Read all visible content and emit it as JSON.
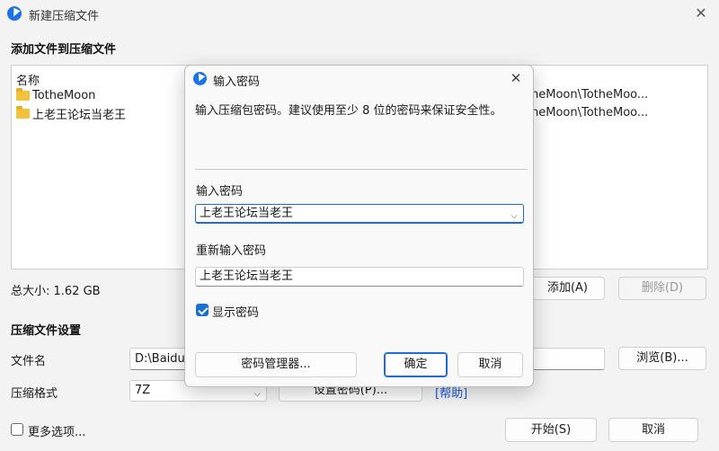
{
  "window": {
    "title": "新建压缩文件",
    "close": "✕"
  },
  "add_section": {
    "heading": "添加文件到压缩文件",
    "list_header": "名称",
    "items": [
      {
        "name": "TotheMoon",
        "path": "heMoon\\TotheMoo..."
      },
      {
        "name": "上老王论坛当老王",
        "path": "heMoon\\TotheMoo..."
      }
    ],
    "total_size": "总大小: 1.62 GB",
    "add_button": "添加(A)",
    "delete_button": "删除(D)"
  },
  "settings_section": {
    "heading": "压缩文件设置",
    "filename_label": "文件名",
    "filename_value": "D:\\BaiduN",
    "browse_button": "浏览(B)...",
    "format_label": "压缩格式",
    "format_value": "7Z",
    "set_password_button": "设置密码(P)...",
    "help_link": "[帮助]"
  },
  "footer": {
    "more_options": "更多选项...",
    "start_button": "开始(S)",
    "cancel_button": "取消"
  },
  "dialog": {
    "title": "输入密码",
    "close": "✕",
    "description": "输入压缩包密码。建议使用至少 8 位的密码来保证安全性。",
    "password_label": "输入密码",
    "password_value": "上老王论坛当老王",
    "confirm_label": "重新输入密码",
    "confirm_value": "上老王论坛当老王",
    "show_password_label": "显示密码",
    "show_password_checked": true,
    "manager_button": "密码管理器...",
    "ok_button": "确定",
    "cancel_button": "取消"
  },
  "colors": {
    "accent": "#1a6fd1",
    "link": "#1a56db",
    "folder": "#f2c23b"
  }
}
